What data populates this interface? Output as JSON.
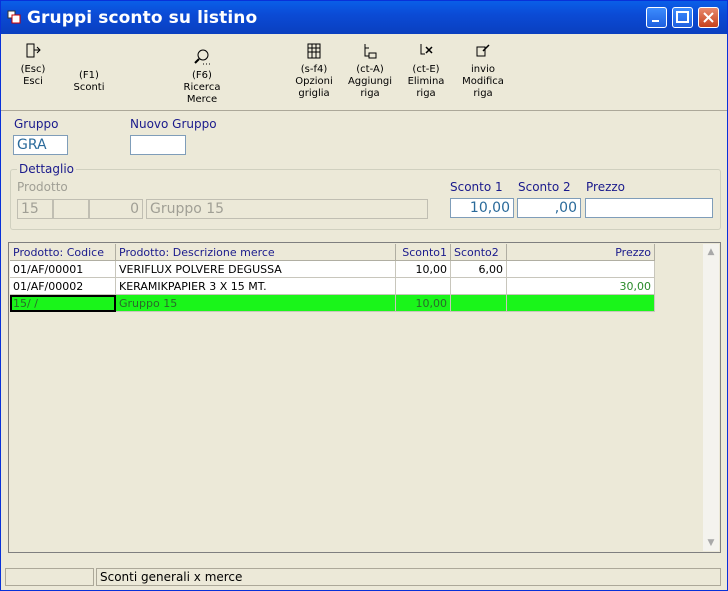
{
  "window": {
    "title": "Gruppi sconto su listino"
  },
  "toolbar": [
    {
      "key": "(Esc)",
      "label1": "Esci",
      "label2": "",
      "label3": "",
      "icon": "exit-door-icon"
    },
    {
      "key": "(F1)",
      "label1": "Sconti",
      "label2": "",
      "label3": "",
      "icon": ""
    },
    {
      "key": "(F6)",
      "label1": "Ricerca",
      "label2": "Merce",
      "label3": "",
      "icon": "search-magnifier-icon"
    },
    {
      "key": "(s-f4)",
      "label1": "Opzioni",
      "label2": "griglia",
      "label3": "",
      "icon": "grid-options-icon"
    },
    {
      "key": "(ct-A)",
      "label1": "Aggiungi",
      "label2": "riga",
      "label3": "",
      "icon": "add-row-icon"
    },
    {
      "key": "(ct-E)",
      "label1": "Elimina",
      "label2": "riga",
      "label3": "",
      "icon": "delete-row-icon"
    },
    {
      "key": "invio",
      "label1": "Modifica",
      "label2": "riga",
      "label3": "",
      "icon": "edit-row-icon"
    }
  ],
  "form": {
    "gruppo_label": "Gruppo",
    "gruppo_value": "GRA",
    "nuovo_gruppo_label": "Nuovo Gruppo",
    "nuovo_gruppo_value": "",
    "dettaglio_label": "Dettaglio",
    "prodotto_label": "Prodotto",
    "prodotto_code1": "15",
    "prodotto_code2": "",
    "prodotto_code3": "0",
    "prodotto_desc": "Gruppo 15",
    "sconto1_label": "Sconto 1",
    "sconto1_value": "10,00",
    "sconto2_label": "Sconto 2",
    "sconto2_value": ",00",
    "prezzo_label": "Prezzo",
    "prezzo_value": ""
  },
  "grid": {
    "columns": [
      "Prodotto: Codice",
      "Prodotto: Descrizione merce",
      "Sconto1",
      "Sconto2",
      "Prezzo"
    ],
    "rows": [
      {
        "codice": "01/AF/00001",
        "descrizione": "VERIFLUX POLVERE DEGUSSA",
        "sconto1": "10,00",
        "sconto2": "6,00",
        "prezzo": ""
      },
      {
        "codice": "01/AF/00002",
        "descrizione": "KERAMIKPAPIER 3 X 15 MT.",
        "sconto1": "",
        "sconto2": "",
        "prezzo": "30,00"
      },
      {
        "codice": "15/  /",
        "descrizione": "Gruppo 15",
        "sconto1": "10,00",
        "sconto2": "",
        "prezzo": ""
      }
    ],
    "scroll_up": "▲",
    "scroll_down": "▼"
  },
  "status": {
    "panel1": "",
    "panel2": "Sconti generali x merce"
  },
  "colors": {
    "titlebar": "#0a5fe8",
    "selected_row": "#1af51a",
    "label": "#1a1a8c",
    "prezzo_green": "#2a8a2a"
  }
}
